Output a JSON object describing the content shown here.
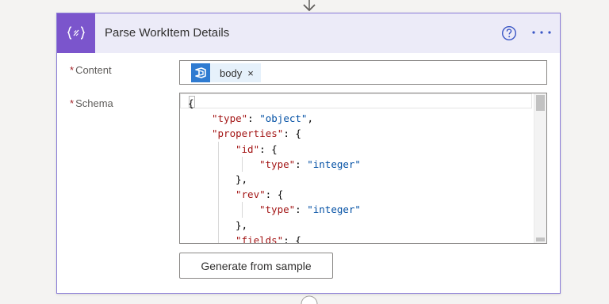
{
  "action": {
    "title": "Parse WorkItem Details",
    "icon": "curly-braces-icon",
    "accent_color": "#7b55cc"
  },
  "header": {
    "help_icon": "help-circle-icon",
    "more_icon": "more-horizontal-icon"
  },
  "fields": {
    "content": {
      "required_marker": "*",
      "label": "Content",
      "token": {
        "label": "body",
        "remove": "×",
        "icon": "azure-devops-icon",
        "color": "#2f7bd1"
      }
    },
    "schema": {
      "required_marker": "*",
      "label": "Schema",
      "lines": [
        {
          "indent": 0,
          "parts": [
            {
              "t": "p",
              "v": "{"
            }
          ]
        },
        {
          "indent": 1,
          "parts": [
            {
              "t": "k",
              "v": "\"type\""
            },
            {
              "t": "p",
              "v": ": "
            },
            {
              "t": "s",
              "v": "\"object\""
            },
            {
              "t": "p",
              "v": ","
            }
          ]
        },
        {
          "indent": 1,
          "parts": [
            {
              "t": "k",
              "v": "\"properties\""
            },
            {
              "t": "p",
              "v": ": {"
            }
          ]
        },
        {
          "indent": 2,
          "parts": [
            {
              "t": "k",
              "v": "\"id\""
            },
            {
              "t": "p",
              "v": ": {"
            }
          ]
        },
        {
          "indent": 3,
          "parts": [
            {
              "t": "k",
              "v": "\"type\""
            },
            {
              "t": "p",
              "v": ": "
            },
            {
              "t": "s",
              "v": "\"integer\""
            }
          ]
        },
        {
          "indent": 2,
          "parts": [
            {
              "t": "p",
              "v": "},"
            }
          ]
        },
        {
          "indent": 2,
          "parts": [
            {
              "t": "k",
              "v": "\"rev\""
            },
            {
              "t": "p",
              "v": ": {"
            }
          ]
        },
        {
          "indent": 3,
          "parts": [
            {
              "t": "k",
              "v": "\"type\""
            },
            {
              "t": "p",
              "v": ": "
            },
            {
              "t": "s",
              "v": "\"integer\""
            }
          ]
        },
        {
          "indent": 2,
          "parts": [
            {
              "t": "p",
              "v": "},"
            }
          ]
        },
        {
          "indent": 2,
          "parts": [
            {
              "t": "k",
              "v": "\"fields\""
            },
            {
              "t": "p",
              "v": ": {"
            }
          ]
        }
      ]
    }
  },
  "buttons": {
    "generate_label": "Generate from sample"
  }
}
